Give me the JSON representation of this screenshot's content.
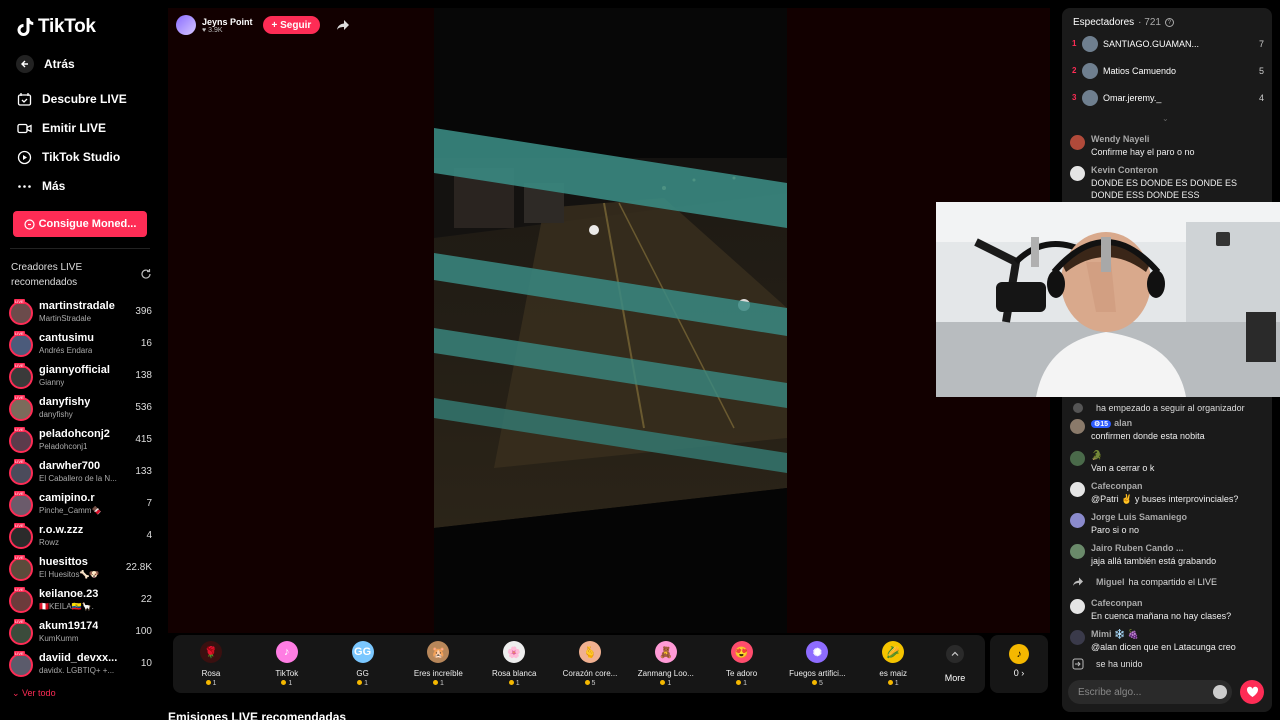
{
  "app": {
    "logo_text": "TikTok"
  },
  "sidebar": {
    "back_label": "Atrás",
    "nav": [
      {
        "label": "Descubre LIVE",
        "icon": "calendar-icon"
      },
      {
        "label": "Emitir LIVE",
        "icon": "camera-icon"
      },
      {
        "label": "TikTok Studio",
        "icon": "play-icon"
      },
      {
        "label": "Más",
        "icon": "more-icon"
      }
    ],
    "coins_button": "Consigue Moned...",
    "recommended_title": "Creadores LIVE recomendados",
    "creators": [
      {
        "name": "martinstradale",
        "sub": "MartinStradale",
        "count": "396"
      },
      {
        "name": "cantusimu",
        "sub": "Andrés Endara",
        "count": "16"
      },
      {
        "name": "giannyofficial",
        "sub": "Gianny",
        "count": "138"
      },
      {
        "name": "danyfishy",
        "sub": "danyfishy",
        "count": "536"
      },
      {
        "name": "peladohconj2",
        "sub": "Peladohconj1",
        "count": "415"
      },
      {
        "name": "darwher700",
        "sub": "El Caballero de la N...",
        "count": "133"
      },
      {
        "name": "camipino.r",
        "sub": "Pinche_Camm🍫",
        "count": "7"
      },
      {
        "name": "r.o.w.zzz",
        "sub": "Rowz",
        "count": "4"
      },
      {
        "name": "huesittos",
        "sub": "El Huesitos🦴🐶",
        "count": "22.8K"
      },
      {
        "name": "keilanoe.23",
        "sub": "🇵🇪KEILA🇪🇨🦙.",
        "count": "22"
      },
      {
        "name": "akum19174",
        "sub": "KumKumm",
        "count": "100"
      },
      {
        "name": "daviid_devxx...",
        "sub": "davidx. LGBTIQ+ +...",
        "count": "10"
      }
    ],
    "view_all": "Ver todo"
  },
  "stream": {
    "host_name": "Jeyns Point",
    "host_likes": "♥ 3.9K",
    "follow_label": "+ Seguir"
  },
  "gifts": [
    {
      "name": "Rosa",
      "price": "1",
      "glyph": "🌹",
      "color": "#3a1010"
    },
    {
      "name": "TikTok",
      "price": "1",
      "glyph": "♪",
      "color": "#ff7de3"
    },
    {
      "name": "GG",
      "price": "1",
      "glyph": "GG",
      "color": "#7ac7ff"
    },
    {
      "name": "Eres increíble",
      "price": "1",
      "glyph": "🐹",
      "color": "#b8875a"
    },
    {
      "name": "Rosa blanca",
      "price": "1",
      "glyph": "🌸",
      "color": "#eeeeee"
    },
    {
      "name": "Corazón core...",
      "price": "5",
      "glyph": "🫰",
      "color": "#f0b090"
    },
    {
      "name": "Zanmang Loo...",
      "price": "1",
      "glyph": "🧸",
      "color": "#ff9ad6"
    },
    {
      "name": "Te adoro",
      "price": "1",
      "glyph": "😍",
      "color": "#ff4d6d"
    },
    {
      "name": "Fuegos artifici...",
      "price": "5",
      "glyph": "✺",
      "color": "#8e6cff"
    },
    {
      "name": "es maiz",
      "price": "1",
      "glyph": "🌽",
      "color": "#f5c400"
    }
  ],
  "more_label": "More",
  "coins_label": "0 ›",
  "section_heading": "Emisiones LIVE recomendadas",
  "chat": {
    "viewers_label": "Espectadores",
    "viewers_count": "· 721",
    "top_viewers": [
      {
        "rank": "1",
        "name": "SANTIAGO.GUAMAN...",
        "score": "7"
      },
      {
        "rank": "2",
        "name": "Matios Camuendo",
        "score": "5"
      },
      {
        "rank": "3",
        "name": "Omar.jeremy._",
        "score": "4"
      }
    ],
    "more_viewers": "⌄",
    "messages_top": [
      {
        "user": "Wendy Nayeli",
        "text": "Confirme hay el paro o no",
        "avatar_color": "#b04a3a"
      },
      {
        "user": "Kevin Conteron",
        "text": "DONDE ES DONDE ES DONDE ES DONDE ESS DONDE ESS",
        "avatar_color": "#e5e5e5"
      }
    ],
    "follow_event": "ha empezado a seguir al organizador",
    "messages_bottom": [
      {
        "badge": "⚙15",
        "user": "alan",
        "text": "confirmen donde esta nobita",
        "avatar_color": "#8a7a6a"
      },
      {
        "user": "🐊",
        "text": "Van a cerrar o k",
        "avatar_color": "#4a6a4a"
      },
      {
        "user": "Cafeconpan",
        "text": "@Patri ✌️ y buses interprovinciales?",
        "avatar_color": "#e5e5e5"
      },
      {
        "user": "Jorge Luis Samaniego",
        "text": "Paro si o no",
        "avatar_color": "#8a8acc"
      },
      {
        "user": "Jairo Ruben Cando ...",
        "text": "jaja allá también está grabando",
        "avatar_color": "#6a8a6a"
      }
    ],
    "share_event_user": "Miguel",
    "share_event_text": "ha compartido el LIVE",
    "messages_last": [
      {
        "user": "Cafeconpan",
        "text": "En cuenca mañana no hay clases?",
        "avatar_color": "#e5e5e5"
      },
      {
        "user": "Mimi ❄️ 🍇",
        "text": "@alan dicen que en Latacunga creo",
        "avatar_color": "#3a3a4a"
      }
    ],
    "join_event": "se ha unido",
    "input_placeholder": "Escribe algo..."
  }
}
